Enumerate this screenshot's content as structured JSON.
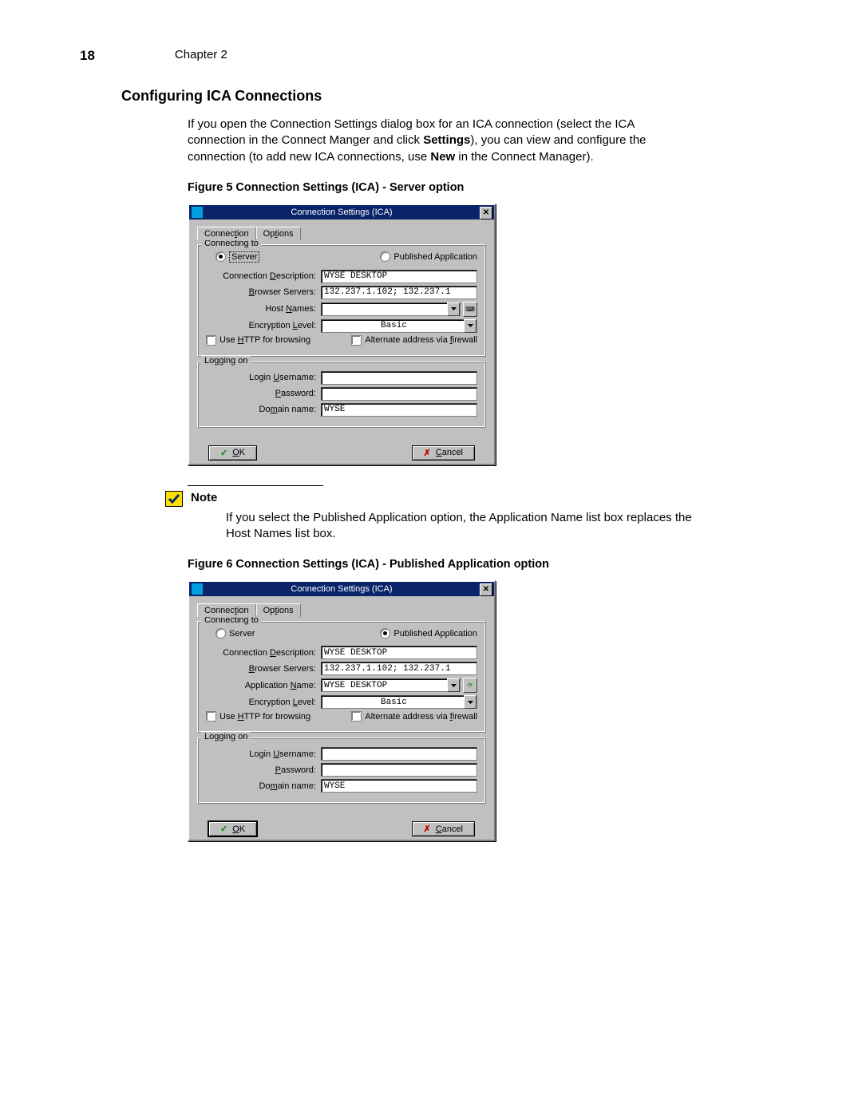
{
  "header": {
    "page_number": "18",
    "chapter": "Chapter 2"
  },
  "section_title": "Configuring ICA Connections",
  "intro": {
    "p1a": "If you open the Connection Settings dialog box for an ICA connection (select the ICA connection in the Connect Manger and click ",
    "p1b": "Settings",
    "p1c": "), you can view and configure the connection (to add new ICA connections, use ",
    "p1d": "New",
    "p1e": " in the Connect Manager)."
  },
  "figure5_caption": "Figure 5    Connection Settings (ICA) - Server option",
  "figure6_caption": "Figure 6    Connection Settings (ICA) - Published Application option",
  "note": {
    "label": "Note",
    "body": "If you select the Published Application option, the Application Name list box replaces the Host Names list box."
  },
  "dialog": {
    "title": "Connection Settings (ICA)",
    "tabs": {
      "connection_pre": "Connec",
      "connection_ul": "t",
      "connection_post": "ion",
      "options_pre": "Op",
      "options_ul": "t",
      "options_post": "ions"
    },
    "fieldset1_legend": "Connecting to",
    "fieldset2_legend": "Logging on",
    "radio_server_pre": "Ser",
    "radio_server_ul": "v",
    "radio_server_post": "er",
    "radio_pub_pre": "Publishe",
    "radio_pub_ul": "d",
    "radio_pub_post": " Application",
    "lbl_desc_pre": "Connection ",
    "lbl_desc_ul": "D",
    "lbl_desc_post": "escription:",
    "lbl_browser_pre": "",
    "lbl_browser_ul": "B",
    "lbl_browser_post": "rowser Servers:",
    "lbl_host_pre": "Host ",
    "lbl_host_ul": "N",
    "lbl_host_post": "ames:",
    "lbl_app_pre": "Application ",
    "lbl_app_ul": "N",
    "lbl_app_post": "ame:",
    "lbl_enc_pre": "Encryption ",
    "lbl_enc_ul": "L",
    "lbl_enc_post": "evel:",
    "chk_http_pre": "Use ",
    "chk_http_ul": "H",
    "chk_http_post": "TTP for browsing",
    "chk_alt_pre": "Alternate address via ",
    "chk_alt_ul": "f",
    "chk_alt_post": "irewall",
    "lbl_login_pre": "Login ",
    "lbl_login_ul": "U",
    "lbl_login_post": "sername:",
    "lbl_pass_pre": "",
    "lbl_pass_ul": "P",
    "lbl_pass_post": "assword:",
    "lbl_domain_pre": "Do",
    "lbl_domain_ul": "m",
    "lbl_domain_post": "ain name:",
    "val_desc": "WYSE DESKTOP",
    "val_browser": "132.237.1.102; 132.237.1",
    "val_host": "",
    "val_app": "WYSE DESKTOP",
    "val_enc": "Basic",
    "val_login": "",
    "val_pass": "",
    "val_domain": "WYSE",
    "btn_ok_ul": "O",
    "btn_ok_post": "K",
    "btn_cancel_ul": "C",
    "btn_cancel_post": "ancel"
  }
}
